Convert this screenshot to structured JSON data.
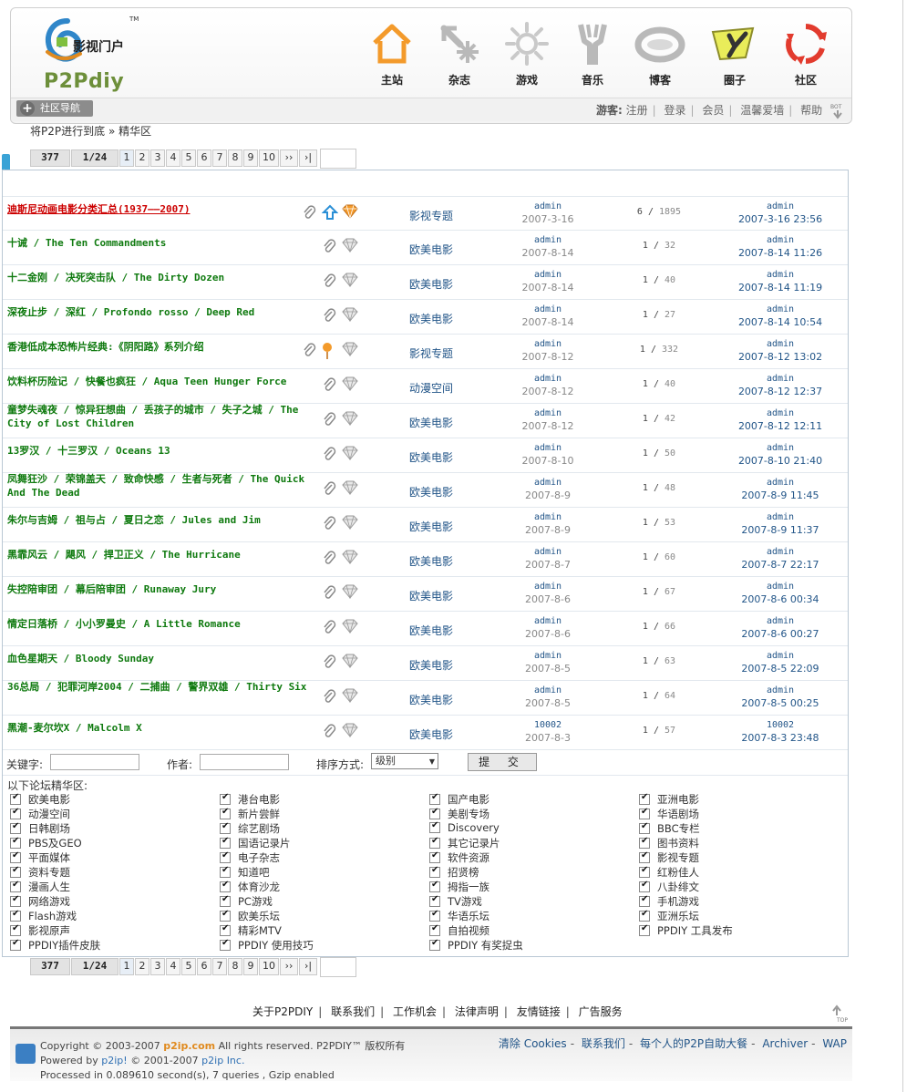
{
  "header": {
    "logo_text": "影视门户",
    "logo_brand": "P2Pdiy",
    "logo_tm": "TM",
    "nav": [
      {
        "label": "主站",
        "icon": "home-icon"
      },
      {
        "label": "杂志",
        "icon": "magazine-icon"
      },
      {
        "label": "游戏",
        "icon": "sun-icon"
      },
      {
        "label": "音乐",
        "icon": "tuning-fork-icon"
      },
      {
        "label": "博客",
        "icon": "blog-ring-icon"
      },
      {
        "label": "圈子",
        "icon": "circle-icon"
      },
      {
        "label": "社区",
        "icon": "recycle-icon"
      }
    ],
    "community_nav_label": "社区导航",
    "guest_label": "游客:",
    "guest_links": [
      "注册",
      "登录",
      "会员",
      "温馨爱墙",
      "帮助"
    ]
  },
  "breadcrumb": {
    "forum": "将P2P进行到底",
    "sep": "»",
    "page": "精华区"
  },
  "pager": {
    "total": "377",
    "pages": "1/24",
    "numbers": [
      "1",
      "2",
      "3",
      "4",
      "5",
      "6",
      "7",
      "8",
      "9",
      "10"
    ],
    "next": "››",
    "last": "›|"
  },
  "threads": [
    {
      "title": "迪斯尼动画电影分类汇总(1937——2007)",
      "highlight": true,
      "icons": [
        "attach",
        "up",
        "gem-orange"
      ],
      "forum": "影视专题",
      "author": "admin",
      "date": "2007-3-16",
      "replies": "6",
      "views": "1895",
      "last_by": "admin",
      "last_time": "2007-3-16 23:56"
    },
    {
      "title": "十诫 / The Ten Commandments",
      "icons": [
        "attach",
        "gem"
      ],
      "forum": "欧美电影",
      "author": "admin",
      "date": "2007-8-14",
      "replies": "1",
      "views": "32",
      "last_by": "admin",
      "last_time": "2007-8-14 11:26"
    },
    {
      "title": "十二金刚 / 决死突击队 / The Dirty Dozen",
      "icons": [
        "attach",
        "gem"
      ],
      "forum": "欧美电影",
      "author": "admin",
      "date": "2007-8-14",
      "replies": "1",
      "views": "40",
      "last_by": "admin",
      "last_time": "2007-8-14 11:19"
    },
    {
      "title": "深夜止步 / 深红 / Profondo rosso / Deep Red",
      "icons": [
        "attach",
        "gem"
      ],
      "forum": "欧美电影",
      "author": "admin",
      "date": "2007-8-14",
      "replies": "1",
      "views": "27",
      "last_by": "admin",
      "last_time": "2007-8-14 10:54"
    },
    {
      "title": "香港低成本恐怖片经典:《阴阳路》系列介绍",
      "icons": [
        "attach",
        "pin",
        "gem"
      ],
      "forum": "影视专题",
      "author": "admin",
      "date": "2007-8-12",
      "replies": "1",
      "views": "332",
      "last_by": "admin",
      "last_time": "2007-8-12 13:02"
    },
    {
      "title": "饮料杯历险记 / 快餐也疯狂 / Aqua Teen Hunger Force",
      "icons": [
        "attach",
        "gem"
      ],
      "forum": "动漫空间",
      "author": "admin",
      "date": "2007-8-12",
      "replies": "1",
      "views": "40",
      "last_by": "admin",
      "last_time": "2007-8-12 12:37"
    },
    {
      "title": "童梦失魂夜 / 惊异狂想曲 / 丢孩子的城市 / 失子之城 / The City of Lost Children",
      "icons": [
        "attach",
        "gem"
      ],
      "forum": "欧美电影",
      "author": "admin",
      "date": "2007-8-12",
      "replies": "1",
      "views": "42",
      "last_by": "admin",
      "last_time": "2007-8-12 12:11"
    },
    {
      "title": "13罗汉 / 十三罗汉 / Oceans 13",
      "icons": [
        "attach",
        "gem"
      ],
      "forum": "欧美电影",
      "author": "admin",
      "date": "2007-8-10",
      "replies": "1",
      "views": "50",
      "last_by": "admin",
      "last_time": "2007-8-10 21:40"
    },
    {
      "title": "凤舞狂沙 / 荣锦盖天 / 致命快感 / 生者与死者 / The Quick And The Dead",
      "icons": [
        "attach",
        "gem"
      ],
      "forum": "欧美电影",
      "author": "admin",
      "date": "2007-8-9",
      "replies": "1",
      "views": "48",
      "last_by": "admin",
      "last_time": "2007-8-9 11:45"
    },
    {
      "title": "朱尔与吉姆 / 祖与占 / 夏日之恋 / Jules and Jim",
      "icons": [
        "attach",
        "gem"
      ],
      "forum": "欧美电影",
      "author": "admin",
      "date": "2007-8-9",
      "replies": "1",
      "views": "53",
      "last_by": "admin",
      "last_time": "2007-8-9 11:37"
    },
    {
      "title": "黑霏风云 / 飓风 / 捍卫正义 / The Hurricane",
      "icons": [
        "attach",
        "gem"
      ],
      "forum": "欧美电影",
      "author": "admin",
      "date": "2007-8-7",
      "replies": "1",
      "views": "60",
      "last_by": "admin",
      "last_time": "2007-8-7 22:17"
    },
    {
      "title": "失控陪审团 / 幕后陪审团 / Runaway Jury",
      "icons": [
        "attach",
        "gem"
      ],
      "forum": "欧美电影",
      "author": "admin",
      "date": "2007-8-6",
      "replies": "1",
      "views": "67",
      "last_by": "admin",
      "last_time": "2007-8-6 00:34"
    },
    {
      "title": "情定日落桥 / 小小罗曼史 / A Little Romance",
      "icons": [
        "attach",
        "gem"
      ],
      "forum": "欧美电影",
      "author": "admin",
      "date": "2007-8-6",
      "replies": "1",
      "views": "66",
      "last_by": "admin",
      "last_time": "2007-8-6 00:27"
    },
    {
      "title": "血色星期天 / Bloody Sunday",
      "icons": [
        "attach",
        "gem"
      ],
      "forum": "欧美电影",
      "author": "admin",
      "date": "2007-8-5",
      "replies": "1",
      "views": "63",
      "last_by": "admin",
      "last_time": "2007-8-5 22:09"
    },
    {
      "title": "36总局 / 犯罪河岸2004 / 二捕曲 / 警界双雄 / Thirty Six",
      "icons": [
        "attach",
        "gem"
      ],
      "forum": "欧美电影",
      "author": "admin",
      "date": "2007-8-5",
      "replies": "1",
      "views": "64",
      "last_by": "admin",
      "last_time": "2007-8-5 00:25"
    },
    {
      "title": "黑潮-麦尔坎X / Malcolm X",
      "icons": [
        "attach",
        "gem"
      ],
      "forum": "欧美电影",
      "author": "10002",
      "date": "2007-8-3",
      "replies": "1",
      "views": "57",
      "last_by": "10002",
      "last_time": "2007-8-3 23:48"
    }
  ],
  "search": {
    "keyword_label": "关键字:",
    "author_label": "作者:",
    "sort_label": "排序方式:",
    "sort_value": "级别",
    "submit_label": "提  交"
  },
  "forums": {
    "heading": "以下论坛精华区:",
    "columns": [
      [
        "欧美电影",
        "动漫空间",
        "日韩剧场",
        "PBS及GEO",
        "平面媒体",
        "资料专题",
        "漫画人生",
        "网络游戏",
        "Flash游戏",
        "影视原声",
        "PPDIY插件皮肤"
      ],
      [
        "港台电影",
        "新片尝鲜",
        "综艺剧场",
        "国语记录片",
        "电子杂志",
        "知道吧",
        "体育沙龙",
        "PC游戏",
        "欧美乐坛",
        "精彩MTV",
        "PPDIY 使用技巧"
      ],
      [
        "国产电影",
        "美剧专场",
        "Discovery",
        "其它记录片",
        "软件资源",
        "招贤榜",
        "拇指一族",
        "TV游戏",
        "华语乐坛",
        "自拍视频",
        "PPDIY 有奖捉虫"
      ],
      [
        "亚洲电影",
        "华语剧场",
        "BBC专栏",
        "图书资料",
        "影视专题",
        "红粉佳人",
        "八卦绯文",
        "手机游戏",
        "亚洲乐坛",
        "PPDIY 工具发布"
      ]
    ]
  },
  "footer": {
    "links": [
      "关于P2PDIY",
      "联系我们",
      "工作机会",
      "法律声明",
      "友情链接",
      "广告服务"
    ],
    "copyright_prefix": "Copyright © 2003-2007",
    "copyright_site": "p2ip.com",
    "copyright_suffix": "All rights reserved. P2PDIY™ 版权所有",
    "powered_prefix": "Powered by",
    "powered_link": "p2ip!",
    "powered_mid": "© 2001-2007",
    "powered_link2": "p2ip Inc.",
    "processed": "Processed in 0.089610 second(s), 7 queries , Gzip enabled",
    "right_links": [
      "清除 Cookies",
      "联系我们",
      "每个人的P2P自助大餐",
      "Archiver",
      "WAP"
    ]
  },
  "colors": {
    "title_green": "#0f7a0f",
    "title_red": "#cc0000",
    "link_blue": "#225588",
    "border_blue": "#b9c7d4"
  }
}
